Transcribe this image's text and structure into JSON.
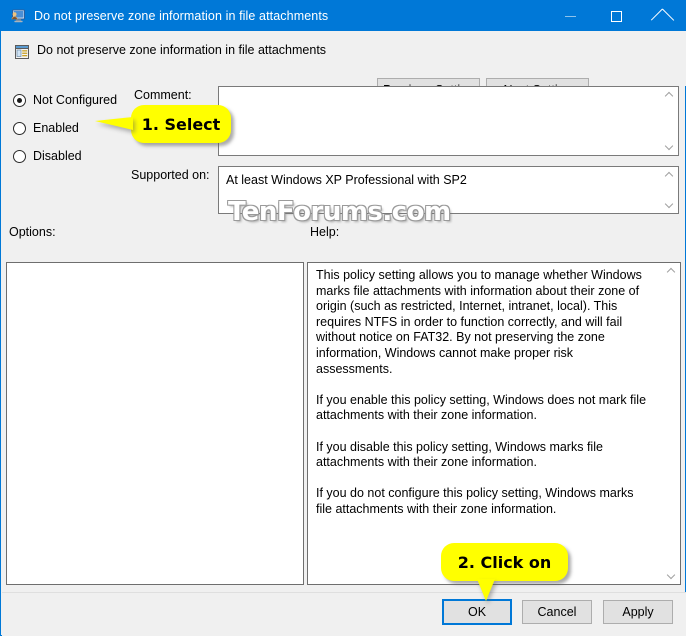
{
  "window": {
    "title": "Do not preserve zone information in file attachments",
    "icon": "computer-user-icon",
    "accent_color": "#0078d7",
    "caption": {
      "minimize_label": "Minimize",
      "maximize_label": "Maximize",
      "close_label": "Close"
    }
  },
  "header": {
    "policy_icon": "group-policy-setting-icon",
    "policy_title": "Do not preserve zone information in file attachments",
    "previous_setting_label": "Previous Setting",
    "next_setting_label": "Next Setting"
  },
  "state": {
    "options": [
      {
        "label": "Not Configured",
        "selected": true
      },
      {
        "label": "Enabled",
        "selected": false
      },
      {
        "label": "Disabled",
        "selected": false
      }
    ]
  },
  "comment": {
    "label": "Comment:",
    "value": "",
    "placeholder": ""
  },
  "supported": {
    "label": "Supported on:",
    "value": "At least Windows XP Professional with SP2"
  },
  "panes": {
    "options_label": "Options:",
    "options_value": "",
    "help_label": "Help:",
    "help_text": "This policy setting allows you to manage whether Windows marks file attachments with information about their zone of origin (such as restricted, Internet, intranet, local). This requires NTFS in order to function correctly, and will fail without notice on FAT32. By not preserving the zone information, Windows cannot make proper risk assessments.\n\nIf you enable this policy setting, Windows does not mark file attachments with their zone information.\n\nIf you disable this policy setting, Windows marks file attachments with their zone information.\n\nIf you do not configure this policy setting, Windows marks file attachments with their zone information."
  },
  "footer": {
    "ok_label": "OK",
    "cancel_label": "Cancel",
    "apply_label": "Apply"
  },
  "annotations": {
    "step1": "1. Select",
    "step2": "2. Click on",
    "callout_color": "#ffff00"
  },
  "watermark": {
    "text": "TenForums.com"
  }
}
